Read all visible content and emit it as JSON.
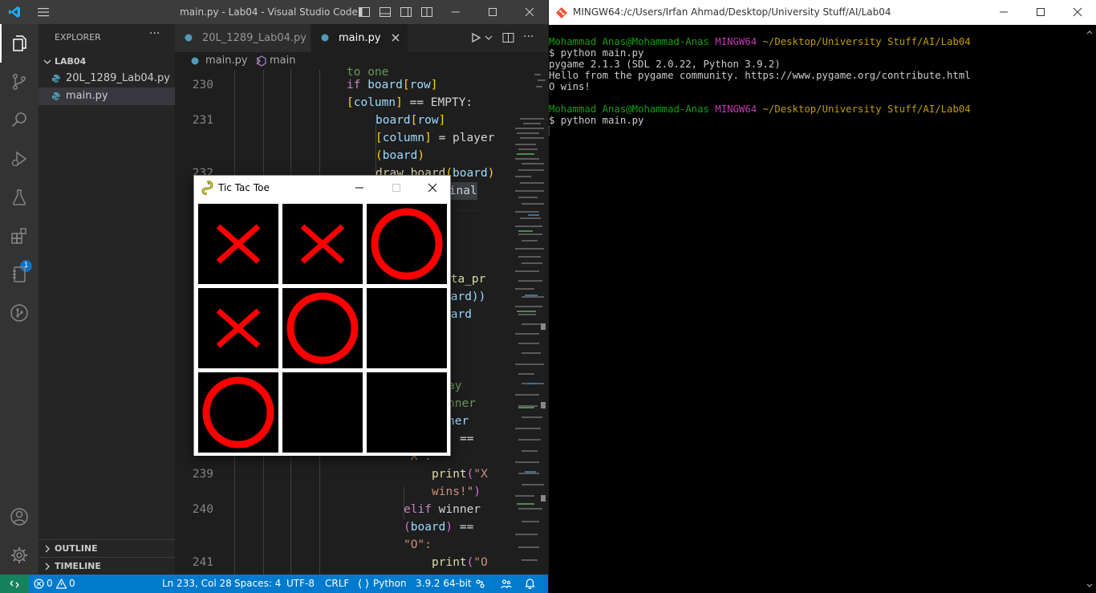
{
  "vscode": {
    "title": "main.py - Lab04 - Visual Studio Code",
    "sidebar": {
      "title": "EXPLORER",
      "folder": "LAB04",
      "files": [
        {
          "label": "20L_1289_Lab04.py"
        },
        {
          "label": "main.py",
          "selected": true
        }
      ],
      "outline_label": "OUTLINE",
      "timeline_label": "TIMELINE",
      "extensions_badge": "1"
    },
    "tabs": [
      {
        "label": "20L_1289_Lab04.py",
        "active": false
      },
      {
        "label": "main.py",
        "active": true
      }
    ],
    "breadcrumb": {
      "file": "main.py",
      "symbol": "main"
    },
    "line_numbers": {
      "l230": "230",
      "l231": "231",
      "l232": "232",
      "l239": "239",
      "l240": "240",
      "l241": "241"
    },
    "code_fragments": {
      "c0": "to one",
      "c1a": "if",
      "c1b": "board",
      "c1c": "[",
      "c1d": "row",
      "c1e": "]",
      "c2a": "[",
      "c2b": "column",
      "c2c": "]",
      "c2d": " == EMPTY:",
      "c3a": "board",
      "c3b": "[",
      "c3c": "row",
      "c3d": "]",
      "c4a": "[",
      "c4b": "column",
      "c4c": "]",
      "c4d": " = player",
      "c5a": "(",
      "c5b": "board",
      "c5c": ")",
      "c6a": "draw_board",
      "c6b": "(",
      "c6c": "board",
      "c6d": ")",
      "c7": "minal",
      "c8": ":",
      "c9a": "eta_pr",
      "c10a": "oard))",
      "c11a": "oard",
      "c12a": "ay",
      "c13a": "nner",
      "c14a": "ner",
      "c15a": "==",
      "c16a": "'X':",
      "c17a": "print",
      "c17b": "(",
      "c17c": "\"X",
      "c18a": "wins!\"",
      "c18b": ")",
      "c19a": "elif",
      "c19b": " winner",
      "c20a": "(",
      "c20b": "board",
      "c20c": ")",
      "c20d": " ==",
      "c21a": "\"O\":",
      "c22a": "print",
      "c22b": "(",
      "c22c": "\"O"
    },
    "status": {
      "errors": "0",
      "warnings": "0",
      "position": "Ln 233, Col 28",
      "spaces": "Spaces: 4",
      "encoding": "UTF-8",
      "eol": "CRLF",
      "language": "Python",
      "interpreter": "3.9.2 64-bit"
    }
  },
  "terminal": {
    "title": "MINGW64:/c/Users/Irfan Ahmad/Desktop/University Stuff/AI/Lab04",
    "prompt_user": "Mohammad Anas@Mohammad-Anas",
    "prompt_env": "MINGW64",
    "prompt_path": "~/Desktop/University Stuff/AI/Lab04",
    "lines": [
      "$ python main.py",
      "pygame 2.1.3 (SDL 2.0.22, Python 3.9.2)",
      "Hello from the pygame community. https://www.pygame.org/contribute.html",
      "O wins!"
    ],
    "last_command": "$ python main.py"
  },
  "tictactoe": {
    "title": "Tic Tac Toe",
    "board": [
      [
        "X",
        "X",
        "O"
      ],
      [
        "X",
        "O",
        ""
      ],
      [
        "O",
        "",
        ""
      ]
    ],
    "mark_color": "#ff0000"
  },
  "colors": {
    "vscode_blue": "#007acc",
    "term_green": "#13a10e",
    "term_magenta": "#c239b3",
    "term_yellow": "#c19c00"
  }
}
